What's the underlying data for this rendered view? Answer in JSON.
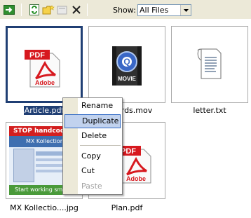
{
  "toolbar": {
    "show_label": "Show:",
    "filter_value": "All Files"
  },
  "files": [
    {
      "name": "Article.pdf",
      "icon": "pdf-icon",
      "selected": true
    },
    {
      "name": "Birds.mov",
      "label": "rds.mov",
      "icon": "quicktime-movie-icon"
    },
    {
      "name": "letter.txt",
      "icon": "text-document-icon"
    },
    {
      "name": "MX Kollectio....jpg",
      "icon": "image-thumbnail"
    },
    {
      "name": "Plan.pdf",
      "icon": "pdf-icon"
    }
  ],
  "thumbnail": {
    "banner": "STOP handcodi",
    "title": "MX Kollection",
    "footer": "Start working smart n"
  },
  "pdf_badge": "PDF",
  "pdf_brand": "Adobe",
  "movie_badge": "MOVIE",
  "context_menu": {
    "items": [
      {
        "label": "Rename"
      },
      {
        "label": "Duplicate"
      },
      {
        "label": "Delete"
      },
      {
        "label": "Copy"
      },
      {
        "label": "Cut"
      },
      {
        "label": "Paste"
      }
    ]
  },
  "colors": {
    "toolbar_bg": "#ece9d8",
    "selection": "#203f74",
    "menu_highlight": "#c1d2ee",
    "pdf_red": "#d7191f"
  }
}
